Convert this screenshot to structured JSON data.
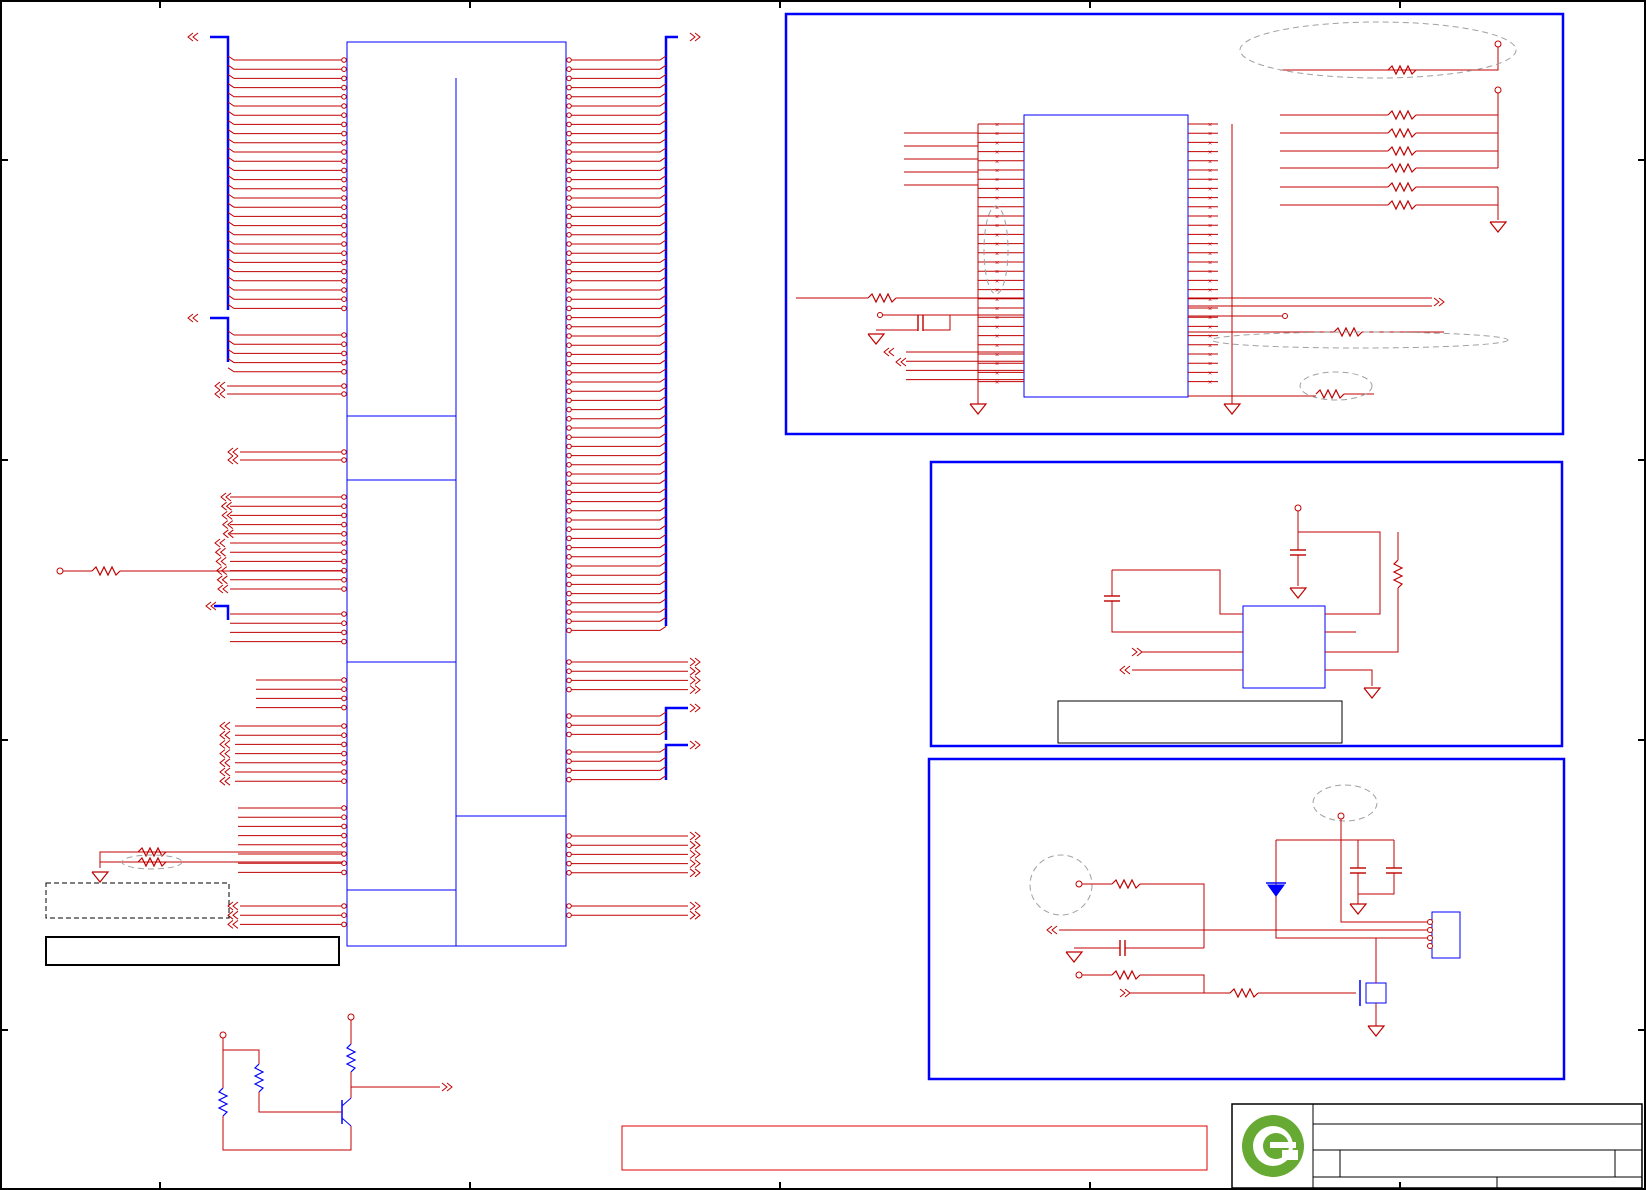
{
  "sheet": {
    "background": "#ffffff",
    "colors": {
      "wire": "#c00000",
      "bus": "#0000ff",
      "frame": "#0000ff",
      "component": "#2020c0",
      "ground": "#c00000",
      "net_port": "#c00000",
      "highlight_ellipse": "#a0a0a0",
      "logo_green": "#66aa33",
      "title_block": "#000000"
    },
    "header_zones": 6,
    "side_zones": 4
  },
  "blocks": {
    "connector_block": "main connector symbol with left and right pin rows",
    "memory_block": "blue frame with IC and resistor array",
    "regulator_block": "blue frame with IC, capacitors and resistor",
    "power_switch_block": "blue frame with diode, MOSFET and connector"
  },
  "notes": {
    "dashed_note": "",
    "left_note_box": "",
    "regulator_note_box": "",
    "red_note_box": ""
  },
  "title_block": {
    "logo": "green-circular-logo",
    "rows": [
      "",
      "",
      ""
    ]
  }
}
